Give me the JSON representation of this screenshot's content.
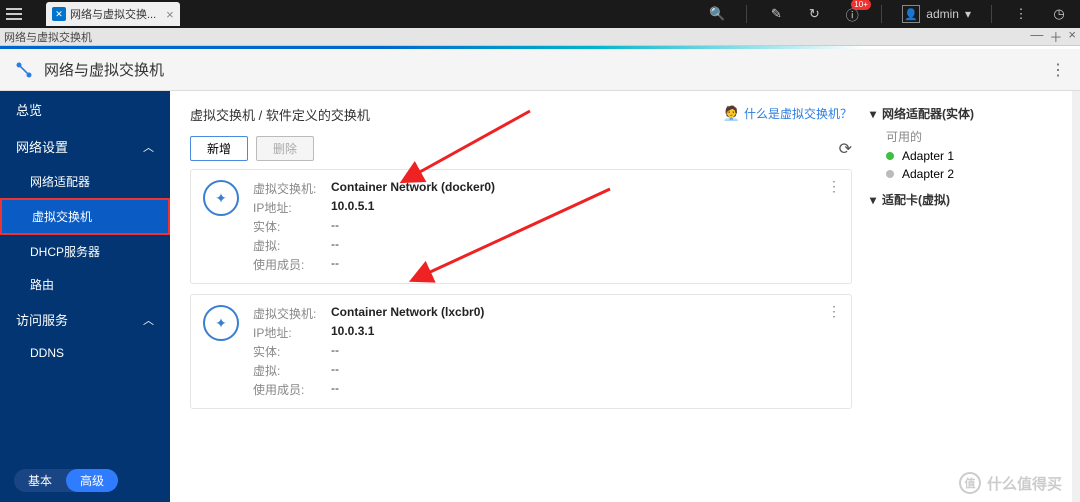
{
  "topbar": {
    "tab_title": "网络与虚拟交换...",
    "badge": "10+",
    "user": "admin"
  },
  "subbar": {
    "title": "网络与虚拟交换机"
  },
  "app": {
    "title": "网络与虚拟交换机"
  },
  "sidebar": {
    "overview": "总览",
    "network_settings": "网络设置",
    "adapters": "网络适配器",
    "virtual_switch": "虚拟交换机",
    "dhcp": "DHCP服务器",
    "route": "路由",
    "access_service": "访问服务",
    "ddns": "DDNS",
    "seg_basic": "基本",
    "seg_advanced": "高级"
  },
  "content": {
    "breadcrumb": "虚拟交换机 / 软件定义的交换机",
    "help": "什么是虚拟交换机？",
    "btn_new": "新增",
    "btn_delete": "删除",
    "labels": {
      "vswitch": "虚拟交换机:",
      "ip": "IP地址:",
      "entity": "实体:",
      "virtual": "虚拟:",
      "members": "使用成员:"
    },
    "cards": [
      {
        "name": "Container Network (docker0)",
        "ip": "10.0.5.1",
        "entity": "--",
        "virtual": "--",
        "members": "--"
      },
      {
        "name": "Container Network (lxcbr0)",
        "ip": "10.0.3.1",
        "entity": "--",
        "virtual": "--",
        "members": "--"
      }
    ]
  },
  "right": {
    "adapter_head": "网络适配器(实体)",
    "available": "可用的",
    "adapters": [
      "Adapter 1",
      "Adapter 2"
    ],
    "nic_head": "适配卡(虚拟)"
  },
  "watermark": {
    "badge": "值",
    "text": "什么值得买"
  }
}
